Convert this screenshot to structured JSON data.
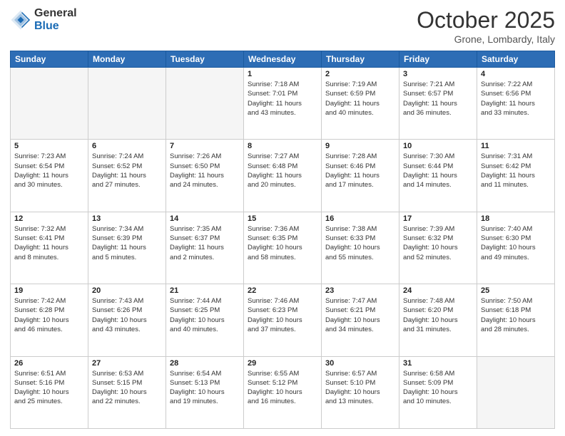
{
  "logo": {
    "general": "General",
    "blue": "Blue"
  },
  "header": {
    "month": "October 2025",
    "location": "Grone, Lombardy, Italy"
  },
  "weekdays": [
    "Sunday",
    "Monday",
    "Tuesday",
    "Wednesday",
    "Thursday",
    "Friday",
    "Saturday"
  ],
  "weeks": [
    [
      {
        "day": "",
        "info": ""
      },
      {
        "day": "",
        "info": ""
      },
      {
        "day": "",
        "info": ""
      },
      {
        "day": "1",
        "info": "Sunrise: 7:18 AM\nSunset: 7:01 PM\nDaylight: 11 hours\nand 43 minutes."
      },
      {
        "day": "2",
        "info": "Sunrise: 7:19 AM\nSunset: 6:59 PM\nDaylight: 11 hours\nand 40 minutes."
      },
      {
        "day": "3",
        "info": "Sunrise: 7:21 AM\nSunset: 6:57 PM\nDaylight: 11 hours\nand 36 minutes."
      },
      {
        "day": "4",
        "info": "Sunrise: 7:22 AM\nSunset: 6:56 PM\nDaylight: 11 hours\nand 33 minutes."
      }
    ],
    [
      {
        "day": "5",
        "info": "Sunrise: 7:23 AM\nSunset: 6:54 PM\nDaylight: 11 hours\nand 30 minutes."
      },
      {
        "day": "6",
        "info": "Sunrise: 7:24 AM\nSunset: 6:52 PM\nDaylight: 11 hours\nand 27 minutes."
      },
      {
        "day": "7",
        "info": "Sunrise: 7:26 AM\nSunset: 6:50 PM\nDaylight: 11 hours\nand 24 minutes."
      },
      {
        "day": "8",
        "info": "Sunrise: 7:27 AM\nSunset: 6:48 PM\nDaylight: 11 hours\nand 20 minutes."
      },
      {
        "day": "9",
        "info": "Sunrise: 7:28 AM\nSunset: 6:46 PM\nDaylight: 11 hours\nand 17 minutes."
      },
      {
        "day": "10",
        "info": "Sunrise: 7:30 AM\nSunset: 6:44 PM\nDaylight: 11 hours\nand 14 minutes."
      },
      {
        "day": "11",
        "info": "Sunrise: 7:31 AM\nSunset: 6:42 PM\nDaylight: 11 hours\nand 11 minutes."
      }
    ],
    [
      {
        "day": "12",
        "info": "Sunrise: 7:32 AM\nSunset: 6:41 PM\nDaylight: 11 hours\nand 8 minutes."
      },
      {
        "day": "13",
        "info": "Sunrise: 7:34 AM\nSunset: 6:39 PM\nDaylight: 11 hours\nand 5 minutes."
      },
      {
        "day": "14",
        "info": "Sunrise: 7:35 AM\nSunset: 6:37 PM\nDaylight: 11 hours\nand 2 minutes."
      },
      {
        "day": "15",
        "info": "Sunrise: 7:36 AM\nSunset: 6:35 PM\nDaylight: 10 hours\nand 58 minutes."
      },
      {
        "day": "16",
        "info": "Sunrise: 7:38 AM\nSunset: 6:33 PM\nDaylight: 10 hours\nand 55 minutes."
      },
      {
        "day": "17",
        "info": "Sunrise: 7:39 AM\nSunset: 6:32 PM\nDaylight: 10 hours\nand 52 minutes."
      },
      {
        "day": "18",
        "info": "Sunrise: 7:40 AM\nSunset: 6:30 PM\nDaylight: 10 hours\nand 49 minutes."
      }
    ],
    [
      {
        "day": "19",
        "info": "Sunrise: 7:42 AM\nSunset: 6:28 PM\nDaylight: 10 hours\nand 46 minutes."
      },
      {
        "day": "20",
        "info": "Sunrise: 7:43 AM\nSunset: 6:26 PM\nDaylight: 10 hours\nand 43 minutes."
      },
      {
        "day": "21",
        "info": "Sunrise: 7:44 AM\nSunset: 6:25 PM\nDaylight: 10 hours\nand 40 minutes."
      },
      {
        "day": "22",
        "info": "Sunrise: 7:46 AM\nSunset: 6:23 PM\nDaylight: 10 hours\nand 37 minutes."
      },
      {
        "day": "23",
        "info": "Sunrise: 7:47 AM\nSunset: 6:21 PM\nDaylight: 10 hours\nand 34 minutes."
      },
      {
        "day": "24",
        "info": "Sunrise: 7:48 AM\nSunset: 6:20 PM\nDaylight: 10 hours\nand 31 minutes."
      },
      {
        "day": "25",
        "info": "Sunrise: 7:50 AM\nSunset: 6:18 PM\nDaylight: 10 hours\nand 28 minutes."
      }
    ],
    [
      {
        "day": "26",
        "info": "Sunrise: 6:51 AM\nSunset: 5:16 PM\nDaylight: 10 hours\nand 25 minutes."
      },
      {
        "day": "27",
        "info": "Sunrise: 6:53 AM\nSunset: 5:15 PM\nDaylight: 10 hours\nand 22 minutes."
      },
      {
        "day": "28",
        "info": "Sunrise: 6:54 AM\nSunset: 5:13 PM\nDaylight: 10 hours\nand 19 minutes."
      },
      {
        "day": "29",
        "info": "Sunrise: 6:55 AM\nSunset: 5:12 PM\nDaylight: 10 hours\nand 16 minutes."
      },
      {
        "day": "30",
        "info": "Sunrise: 6:57 AM\nSunset: 5:10 PM\nDaylight: 10 hours\nand 13 minutes."
      },
      {
        "day": "31",
        "info": "Sunrise: 6:58 AM\nSunset: 5:09 PM\nDaylight: 10 hours\nand 10 minutes."
      },
      {
        "day": "",
        "info": ""
      }
    ]
  ]
}
